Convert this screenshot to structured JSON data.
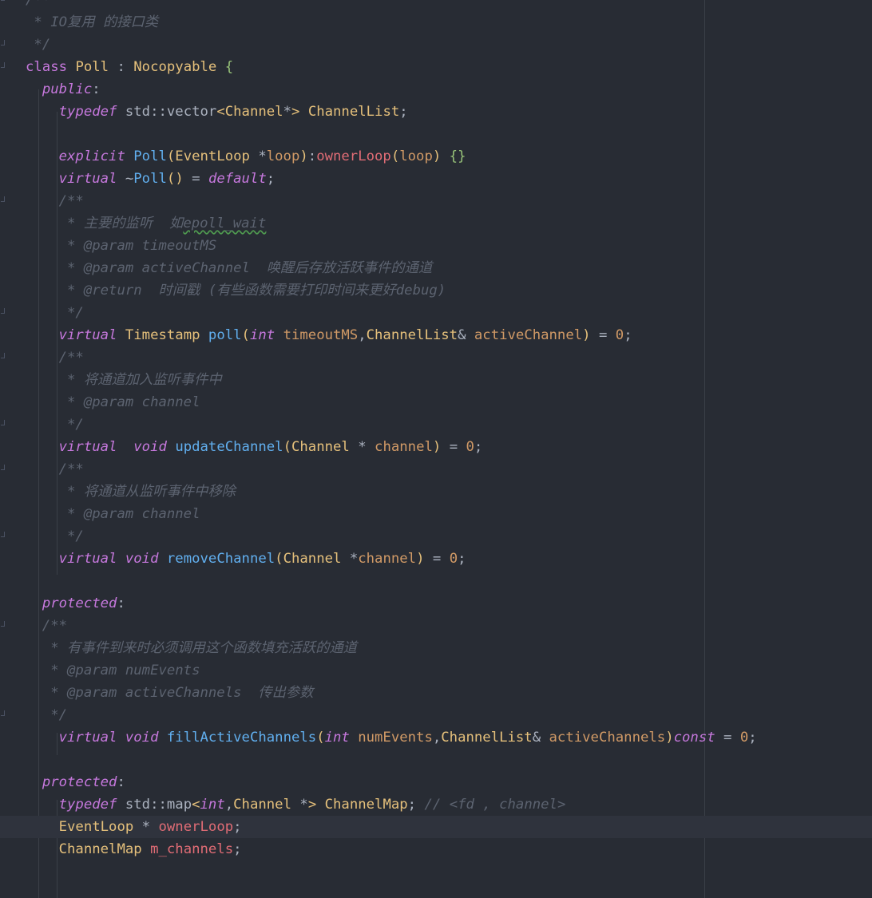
{
  "editor": {
    "accent_colors": {
      "keyword": "#c678dd",
      "type": "#e5c07b",
      "function": "#61afef",
      "member": "#e06c75",
      "param": "#d19a66",
      "comment": "#5c6370",
      "text": "#abb2bf",
      "brace": "#98c379"
    },
    "lines": [
      "/**",
      " * IO复用 的接口类",
      " */",
      "class Poll : Nocopyable {",
      "  public:",
      "    typedef std::vector<Channel*> ChannelList;",
      "",
      "    explicit Poll(EventLoop *loop):ownerLoop(loop) {}",
      "    virtual ~Poll() = default;",
      "    /**",
      "     * 主要的监听  如epoll_wait",
      "     * @param timeoutMS",
      "     * @param activeChannel  唤醒后存放活跃事件的通道",
      "     * @return  时间戳 (有些函数需要打印时间来更好debug)",
      "     */",
      "    virtual Timestamp poll(int timeoutMS,ChannelList& activeChannel) = 0;",
      "    /**",
      "     * 将通道加入监听事件中",
      "     * @param channel",
      "     */",
      "    virtual  void updateChannel(Channel * channel) = 0;",
      "    /**",
      "     * 将通道从监听事件中移除",
      "     * @param channel",
      "     */",
      "    virtual void removeChannel(Channel *channel) = 0;",
      "",
      "  protected:",
      "  /**",
      "   * 有事件到来时必须调用这个函数填充活跃的通道",
      "   * @param numEvents",
      "   * @param activeChannels  传出参数",
      "   */",
      "    virtual void fillActiveChannels(int numEvents,ChannelList& activeChannels)const = 0;",
      "",
      "  protected:",
      "    typedef std::map<int,Channel *> ChannelMap; // <fd , channel>",
      "    EventLoop * ownerLoop;",
      "    ChannelMap m_channels;",
      ""
    ]
  }
}
